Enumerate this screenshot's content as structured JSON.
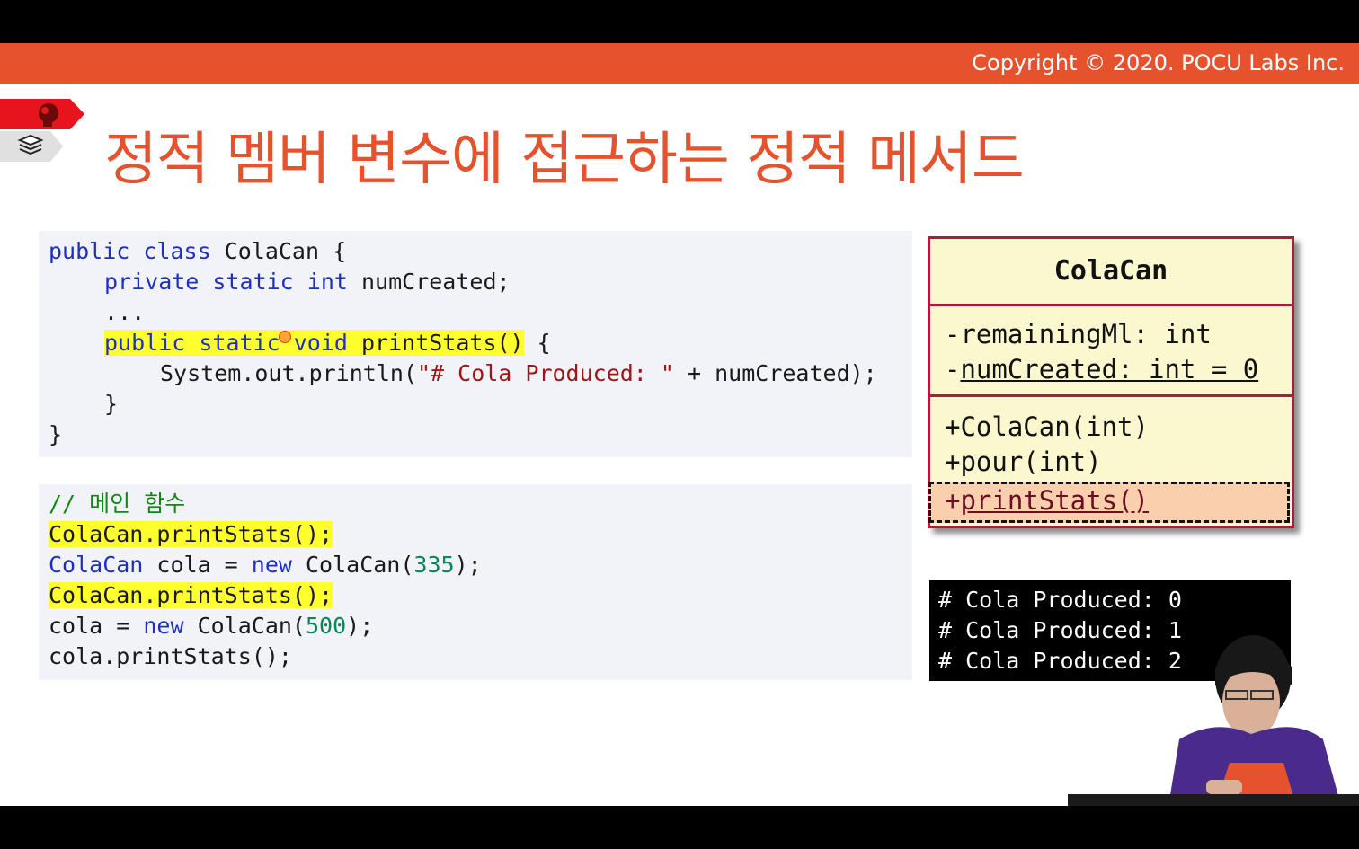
{
  "header": {
    "copyright": "Copyright © 2020. POCU Labs Inc.",
    "accent_color": "#e5532e"
  },
  "title": "정적 멤버 변수에 접근하는 정적 메서드",
  "code_class": {
    "l1_kw": "public class",
    "l1_rest": " ColaCan {",
    "l2_kw": "private static int",
    "l2_rest": " numCreated;",
    "l3": "...",
    "l4_hl_kw": "public static void",
    "l4_hl_rest": " printStats()",
    "l4_rest": " {",
    "l5_pre": "System.out.println(",
    "l5_str": "\"# Cola Produced: \"",
    "l5_post": " + numCreated);",
    "l6": "}",
    "l7": "}"
  },
  "code_main": {
    "comment": "// 메인 함수",
    "l2_hl": "ColaCan.printStats();",
    "l3_kw1": "ColaCan",
    "l3_a": " cola = ",
    "l3_kw2": "new",
    "l3_b": " ColaCan(",
    "l3_num": "335",
    "l3_c": ");",
    "l4_hl": "ColaCan.printStats();",
    "l5_a": "cola = ",
    "l5_kw": "new",
    "l5_b": " ColaCan(",
    "l5_num": "500",
    "l5_c": ");",
    "l6": "cola.printStats();"
  },
  "uml": {
    "class_name": "ColaCan",
    "attr1": "-remainingMl: int",
    "attr2_prefix": "-",
    "attr2_underlined": "numCreated: int = 0",
    "method1": "+ColaCan(int)",
    "method2": "+pour(int)",
    "method3_prefix": "+",
    "method3_underlined": "printStats()"
  },
  "console": {
    "lines": [
      "# Cola Produced: 0",
      "# Cola Produced: 1",
      "# Cola Produced: 2"
    ]
  }
}
